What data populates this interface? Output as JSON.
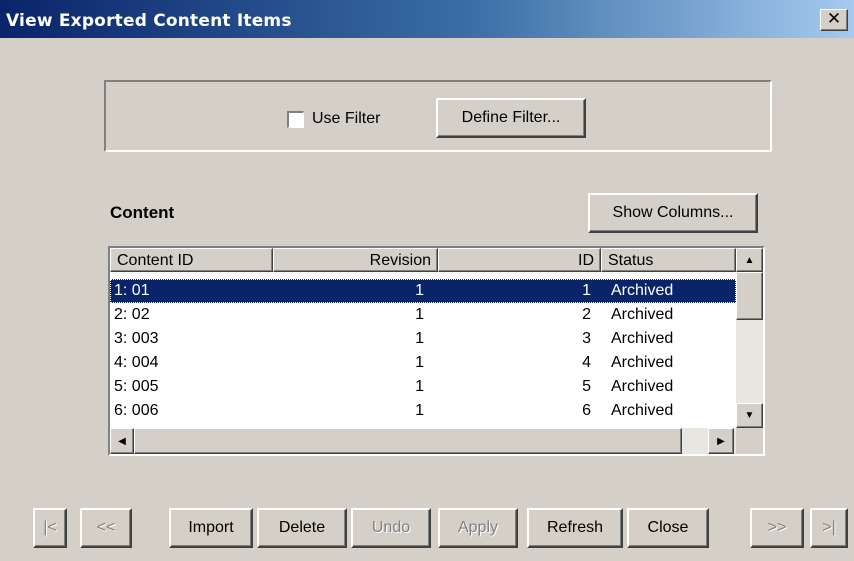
{
  "window": {
    "title": "View Exported Content Items",
    "close_glyph": "✕"
  },
  "filter": {
    "use_filter_label": "Use Filter",
    "use_filter_checked": false,
    "define_filter_label": "Define Filter..."
  },
  "content": {
    "section_label": "Content",
    "show_columns_label": "Show Columns...",
    "columns": [
      "Content ID",
      "Revision",
      "ID",
      "Status"
    ],
    "rows": [
      {
        "content_id": "1: 01",
        "revision": "1",
        "id": "1",
        "status": "Archived",
        "selected": true
      },
      {
        "content_id": "2: 02",
        "revision": "1",
        "id": "2",
        "status": "Archived",
        "selected": false
      },
      {
        "content_id": "3: 003",
        "revision": "1",
        "id": "3",
        "status": "Archived",
        "selected": false
      },
      {
        "content_id": "4: 004",
        "revision": "1",
        "id": "4",
        "status": "Archived",
        "selected": false
      },
      {
        "content_id": "5: 005",
        "revision": "1",
        "id": "5",
        "status": "Archived",
        "selected": false
      },
      {
        "content_id": "6: 006",
        "revision": "1",
        "id": "6",
        "status": "Archived",
        "selected": false
      }
    ]
  },
  "scrollbar_icons": {
    "up": "▲",
    "down": "▼",
    "left": "◀",
    "right": "▶"
  },
  "footer": {
    "first_label": "|<",
    "prev_label": "<<",
    "import_label": "Import",
    "delete_label": "Delete",
    "undo_label": "Undo",
    "apply_label": "Apply",
    "refresh_label": "Refresh",
    "close_label": "Close",
    "next_label": ">>",
    "last_label": ">|"
  },
  "colors": {
    "dialog_bg": "#d4d0c8",
    "title_start": "#0a246a",
    "title_end": "#a6caf0",
    "selection": "#0a246a",
    "disabled_text": "#808080"
  }
}
